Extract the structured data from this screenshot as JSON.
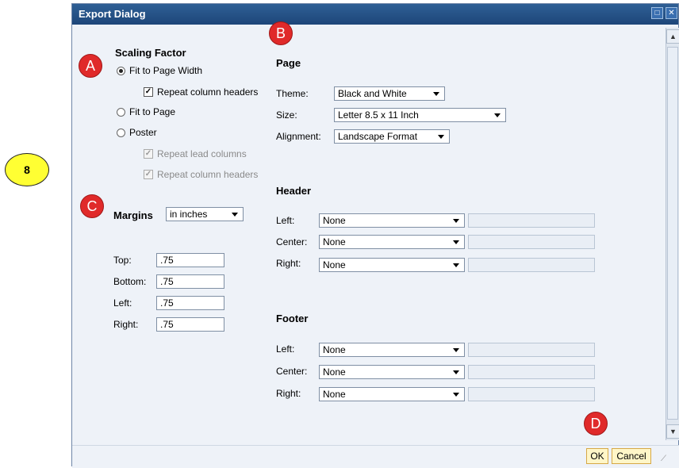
{
  "step_badge": "8",
  "window": {
    "title": "Export Dialog"
  },
  "callouts": {
    "a": "A",
    "b": "B",
    "c": "C",
    "d": "D"
  },
  "scaling": {
    "heading": "Scaling Factor",
    "fit_width": "Fit to Page Width",
    "fit_width_repeat_headers": "Repeat column headers",
    "fit_page": "Fit to Page",
    "poster": "Poster",
    "poster_repeat_lead": "Repeat lead columns",
    "poster_repeat_headers": "Repeat column headers",
    "selected": "Fit to Page Width"
  },
  "margins": {
    "heading": "Margins",
    "unit": "in inches",
    "top_label": "Top:",
    "top": ".75",
    "bottom_label": "Bottom:",
    "bottom": ".75",
    "left_label": "Left:",
    "left": ".75",
    "right_label": "Right:",
    "right": ".75"
  },
  "page": {
    "heading": "Page",
    "theme_label": "Theme:",
    "theme": "Black and White",
    "size_label": "Size:",
    "size": "Letter 8.5 x 11 Inch",
    "alignment_label": "Alignment:",
    "alignment": "Landscape Format"
  },
  "header": {
    "heading": "Header",
    "left_label": "Left:",
    "left": "None",
    "left_text": "",
    "center_label": "Center:",
    "center": "None",
    "center_text": "",
    "right_label": "Right:",
    "right": "None",
    "right_text": ""
  },
  "footer": {
    "heading": "Footer",
    "left_label": "Left:",
    "left": "None",
    "left_text": "",
    "center_label": "Center:",
    "center": "None",
    "center_text": "",
    "right_label": "Right:",
    "right": "None",
    "right_text": ""
  },
  "buttons": {
    "ok": "OK",
    "cancel": "Cancel"
  },
  "colors": {
    "titlebar": "#1d4679",
    "callout": "#e02a2a",
    "badge": "#ffff33",
    "button": "#fff6c8"
  }
}
